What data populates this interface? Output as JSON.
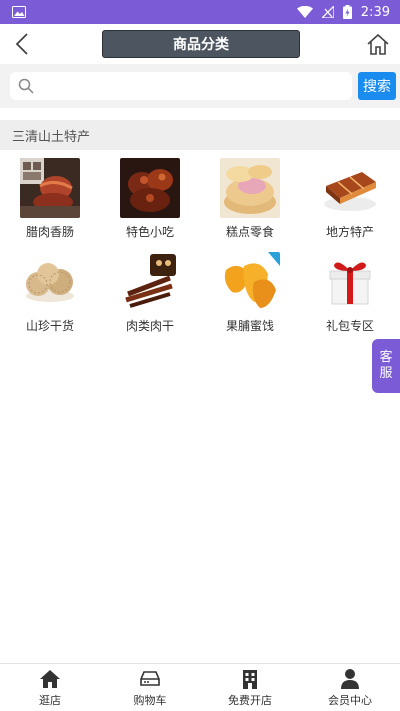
{
  "status_bar": {
    "time": "2:39"
  },
  "header": {
    "title": "商品分类"
  },
  "search": {
    "placeholder": "",
    "button_label": "搜索"
  },
  "section": {
    "title": "三清山土特产"
  },
  "categories": [
    {
      "label": "腊肉香肠",
      "icon": "sausage-image"
    },
    {
      "label": "特色小吃",
      "icon": "snack-image"
    },
    {
      "label": "糕点零食",
      "icon": "pastry-image"
    },
    {
      "label": "地方特产",
      "icon": "specialty-image"
    },
    {
      "label": "山珍干货",
      "icon": "mushroom-image"
    },
    {
      "label": "肉类肉干",
      "icon": "jerky-image"
    },
    {
      "label": "果脯蜜饯",
      "icon": "dried-fruit-image"
    },
    {
      "label": "礼包专区",
      "icon": "gift-image"
    }
  ],
  "service": {
    "line1": "客",
    "line2": "服"
  },
  "bottom_nav": [
    {
      "label": "逛店",
      "icon": "home-icon"
    },
    {
      "label": "购物车",
      "icon": "cart-icon"
    },
    {
      "label": "免费开店",
      "icon": "building-icon"
    },
    {
      "label": "会员中心",
      "icon": "user-icon"
    }
  ],
  "colors": {
    "accent": "#7b5cd6",
    "search_button": "#1a8cf0",
    "title_bg": "#4d5561"
  }
}
